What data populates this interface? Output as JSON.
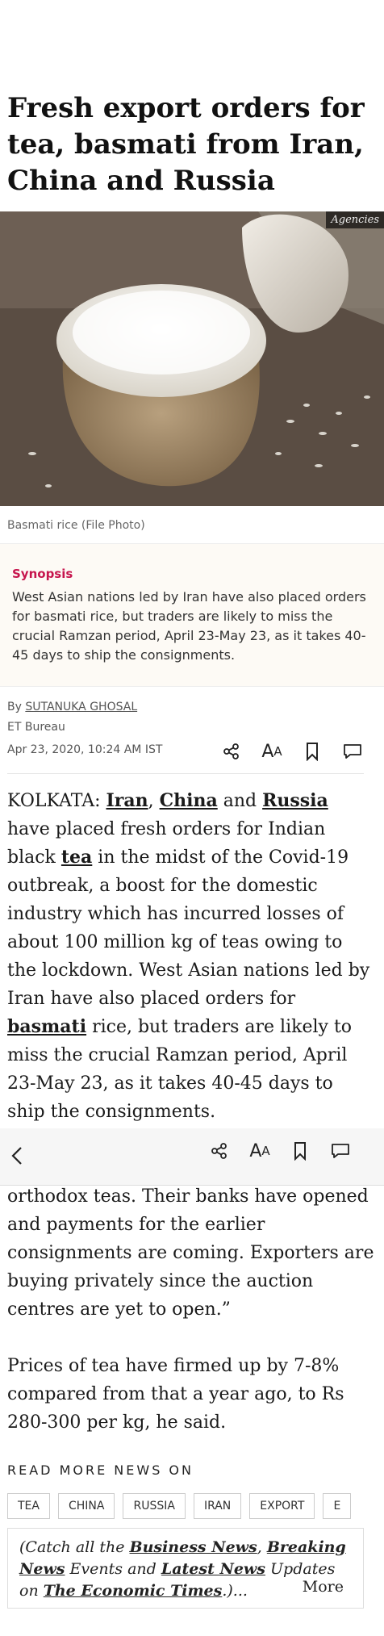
{
  "article": {
    "headline": "Fresh export orders for tea, basmati from Iran, China and Russia",
    "image_credit": "Agencies",
    "image_caption": "Basmati rice (File Photo)"
  },
  "synopsis": {
    "title": "Synopsis",
    "text": "West Asian nations led by Iran have also placed orders for basmati rice, but traders are likely to miss the crucial Ramzan period, April 23-May 23, as it takes 40-45 days to ship the consignments."
  },
  "byline": {
    "prefix": "By ",
    "author": "SUTANUKA GHOSAL",
    "bureau": "ET Bureau",
    "date": "Apr 23, 2020, 10:24 AM IST"
  },
  "toolbar": {
    "font_size_big": "A",
    "font_size_small": "A"
  },
  "body": {
    "p1": {
      "t1": "KOLKATA: ",
      "k1": "Iran",
      "t2": ", ",
      "k2": "China",
      "t3": " and ",
      "k3": "Russia",
      "t4": " have placed fresh orders for Indian black ",
      "k4": "tea",
      "t5": " in the midst of the Covid-19 outbreak, a boost for the domestic industry which has incurred losses of about 100 million kg of teas owing to the lockdown. West Asian nations led by Iran have also placed orders for ",
      "k5": "basmati",
      "t6": " rice, but traders are likely to miss the crucial Ramzan period, April 23-May 23, as it takes 40-45 days to ship the consignments."
    },
    "p2": "orthodox teas. Their banks have opened and payments for the earlier consignments are coming. Exporters are buying privately since the auction centres are yet to open.”",
    "p3": "Prices of tea have firmed up by 7-8% compared from that a year ago, to Rs 280-300 per kg, he said."
  },
  "read_more": {
    "label": "READ MORE NEWS ON",
    "tags": [
      "TEA",
      "CHINA",
      "RUSSIA",
      "IRAN",
      "EXPORT",
      "E"
    ]
  },
  "catch": {
    "t1": "(Catch all the ",
    "k1": "Business News",
    "t2": ", ",
    "k2": "Breaking News",
    "t3": " Events and ",
    "k3": "Latest News",
    "t4": " Updates on ",
    "k4": "The Economic Times",
    "t5": ".)...",
    "more": "More"
  },
  "colors": {
    "synopsis_title": "#c6154d",
    "synopsis_bg": "#fdfaf5",
    "sticky_bg": "#f6f6f6"
  },
  "icons": [
    "share-icon",
    "font-size-icon",
    "bookmark-icon",
    "comment-icon",
    "back-arrow-icon"
  ]
}
